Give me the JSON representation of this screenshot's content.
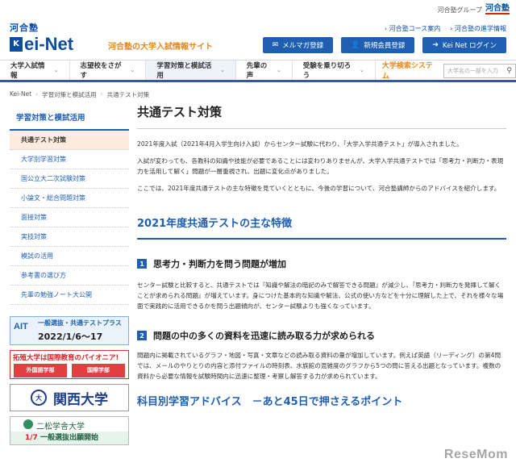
{
  "header": {
    "group_label": "河合塾グループ",
    "group_mark": "河合塾",
    "logo_kawai": "河合塾",
    "logo_kei_box": "K",
    "logo_kei_net": "ei-Net",
    "tagline": "河合塾の大学入試情報サイト",
    "links": [
      "河合塾コース案内",
      "河合塾の進学情報"
    ],
    "buttons": [
      {
        "label": "メルマガ登録",
        "icon": "envelope-icon",
        "glyph": "✉"
      },
      {
        "label": "新規会員登録",
        "icon": "user-icon",
        "glyph": "👤"
      },
      {
        "label": "Kei Net ログイン",
        "icon": "login-icon",
        "glyph": "➔"
      }
    ]
  },
  "nav": {
    "items": [
      "大学入試情報",
      "志望校をさがす",
      "学習対策と模試活用",
      "先輩の声",
      "受験を乗り切ろう"
    ],
    "search_label": "大学検索システム",
    "search_placeholder": "大学名の一部を入力",
    "chev": "⌄",
    "search_glyph": "⚲"
  },
  "breadcrumb": [
    "Kei-Net",
    "学習対策と模試活用",
    "共通テスト対策"
  ],
  "breadcrumb_sep": "›",
  "sidebar": {
    "heading": "学習対策と模試活用",
    "items": [
      "共通テスト対策",
      "大学別学習対策",
      "国公立大二次試験対策",
      "小論文・総合問題対策",
      "面接対策",
      "実技対策",
      "模試の活用",
      "参考書の選び方",
      "先輩の勉強ノート大公開"
    ]
  },
  "banners": {
    "ait_logo": "AIT",
    "ait_line1": "一般選抜・共通テストプラス",
    "ait_line2": "2022/1/6〜17",
    "takushoku_title": "拓殖大学は国際教育のパイオニア!",
    "takushoku_tag_a": "外国語学部",
    "takushoku_tag_b": "国際学部",
    "kansai_seal": "大",
    "kansai_name": "関西大学",
    "nishogakusha_name": "二松学舎大学",
    "nishogakusha_date": "1/7",
    "nishogakusha_desc": "一般選抜出願開始"
  },
  "main": {
    "title": "共通テスト対策",
    "paragraphs": [
      "2021年度入試（2021年4月入学生向け入試）からセンター試験に代わり、「大学入学共通テスト」が導入されました。",
      "入試が変わっても、各教科の知識や技能が必要であることには変わりありませんが、大学入学共通テストでは「思考力・判断力・表現力を活用して解く」問題が一層重視され、出題に変化点がありました。",
      "ここでは、2021年度共通テストの主な特徴を見ていくとともに、今後の学習について、河合塾講師からのアドバイスを紹介します。"
    ],
    "section_title": "2021年度共通テストの主な特徴",
    "features": [
      {
        "num": "1",
        "title": "思考力・判断力を問う問題が増加",
        "body": "センター試験と比較すると、共通テストでは『知識や解法の暗記のみで解答できる問題』が減少し、『思考力・判断力を発揮して解くことが求められる問題』が増えています。身につけた基本的な知識や解法、公式の使い方などを十分に理解した上で、それを様々な場面で実践的に活用できるかを問う出題傾向が、センター試験よりも強くなっています。"
      },
      {
        "num": "2",
        "title": "問題の中の多くの資料を迅速に読み取る力が求められる",
        "body": "問題内に掲載されているグラフ・地図・写真・文章などの読み取る資料の量が増加しています。例えば英語（リーディング）の第4問では、メールのやりとりの内容と添付ファイルの時刻表、水族館の混雑度のグラフから5つの問に答える出題となっています。複数の資料から必要な情報を試験時間内に迅速に整理・考察し解答する力が求められています。"
      }
    ],
    "advice_title": "科目別学習アドバイス　－あと45日で押さえるポイント"
  },
  "watermark": "ReseMom"
}
